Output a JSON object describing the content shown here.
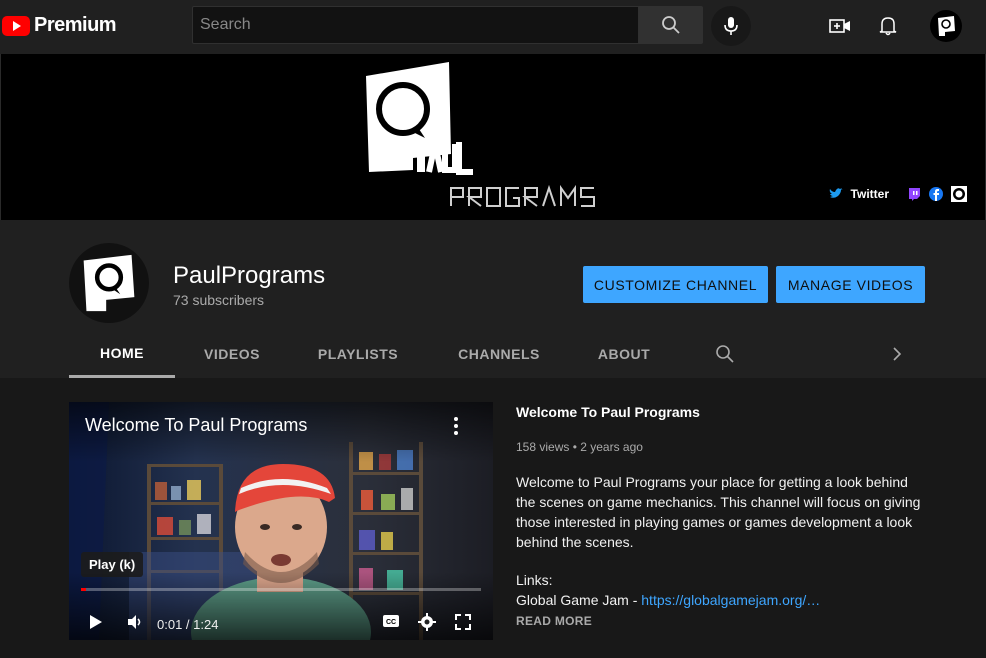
{
  "topbar": {
    "logo_text": "Premium",
    "search_placeholder": "Search"
  },
  "banner": {
    "twitter_label": "Twitter"
  },
  "channel": {
    "name": "PaulPrograms",
    "subscribers": "73 subscribers",
    "customize_label": "CUSTOMIZE CHANNEL",
    "manage_label": "MANAGE VIDEOS"
  },
  "tabs": [
    {
      "label": "HOME"
    },
    {
      "label": "VIDEOS"
    },
    {
      "label": "PLAYLISTS"
    },
    {
      "label": "CHANNELS"
    },
    {
      "label": "ABOUT"
    }
  ],
  "player": {
    "title": "Welcome To Paul Programs",
    "tooltip": "Play (k)",
    "time": "0:01 / 1:24",
    "progress": 0.012
  },
  "video_info": {
    "title": "Welcome To Paul Programs",
    "meta": "158 views • 2 years ago",
    "description": "Welcome to Paul Programs your place for getting a look behind the scenes on game mechanics. This channel will focus on giving those interested in playing games or games development a look behind the scenes.",
    "links_label": "Links:",
    "link_prefix": "Global Game Jam - ",
    "link_url": "https://globalgamejam.org/…",
    "read_more": "READ MORE"
  },
  "colors": {
    "accent": "#3ea6ff",
    "brand": "#ff0000"
  }
}
